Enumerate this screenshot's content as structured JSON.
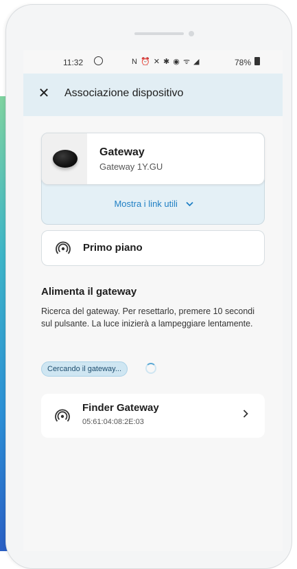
{
  "status_bar": {
    "time": "11:32",
    "icons": "N ⏰ ✕ ✱ ◉ ᯤ ◢",
    "battery": "78%"
  },
  "app_bar": {
    "title": "Associazione dispositivo"
  },
  "device_card": {
    "name": "Gateway",
    "model": "Gateway 1Y.GU",
    "show_links_label": "Mostra i link utili"
  },
  "room_card": {
    "label": "Primo piano"
  },
  "power_section": {
    "title": "Alimenta il gateway",
    "description": "Ricerca del gateway. Per resettarlo, premere 10 secondi sul pulsante. La luce inizierà a lampeggiare lentamente.",
    "search_status": "Cercando il gateway..."
  },
  "found_gateway": {
    "name": "Finder Gateway",
    "mac": "05:61:04:08:2E:03"
  },
  "colors": {
    "accent": "#1f7fc4",
    "appbar_bg": "#e2eef4",
    "pill_bg": "#cfe6f2"
  },
  "icons": {
    "close": "close-icon",
    "chevron_down": "chevron-down-icon",
    "broadcast": "broadcast-icon",
    "chevron_right": "chevron-right-icon"
  }
}
